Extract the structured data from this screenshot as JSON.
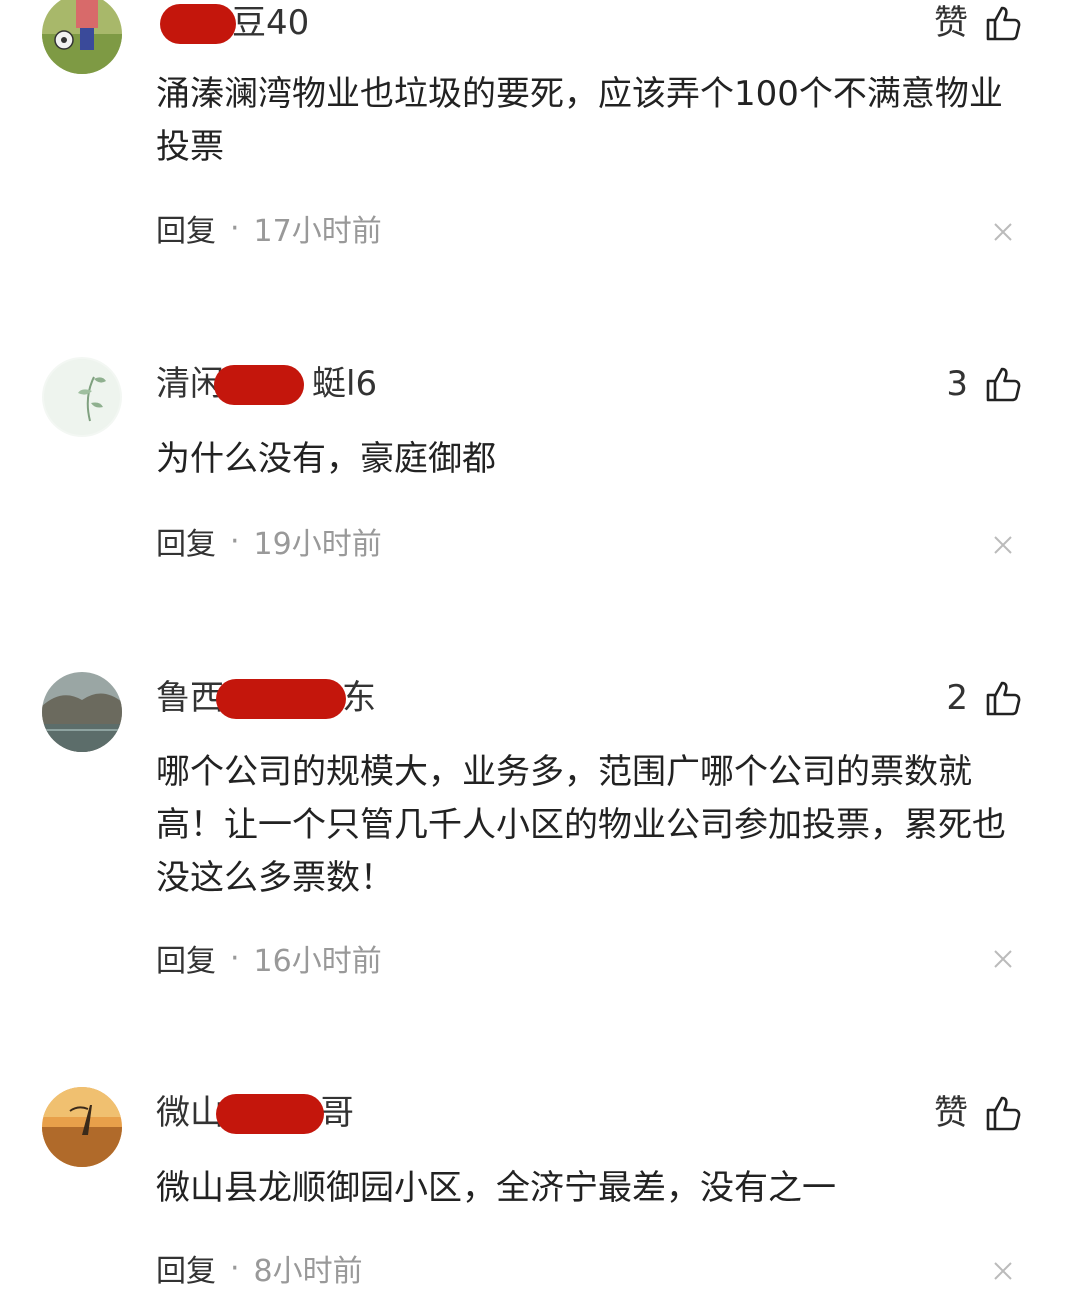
{
  "comments": [
    {
      "username_visible": "豆40",
      "like_label": "赞",
      "text": "涌溱澜湾物业也垃圾的要死，应该弄个100个不满意物业投票",
      "reply_label": "回复",
      "separator": "·",
      "time": "17小时前",
      "avatar_icon": "child-soccer-avatar-icon"
    },
    {
      "username_visible": "清闲蜓l6",
      "like_label": "3",
      "text": "为什么没有，豪庭御都",
      "reply_label": "回复",
      "separator": "·",
      "time": "19小时前",
      "avatar_icon": "ink-plant-avatar-icon"
    },
    {
      "username_visible": "鲁西东",
      "like_label": "2",
      "text": "哪个公司的规模大，业务多，范围广哪个公司的票数就高！让一个只管几千人小区的物业公司参加投票，累死也没这么多票数！",
      "reply_label": "回复",
      "separator": "·",
      "time": "16小时前",
      "avatar_icon": "landscape-avatar-icon"
    },
    {
      "username_visible": "微山哥",
      "like_label": "赞",
      "text": "微山县龙顺御园小区，全济宁最差，没有之一",
      "reply_label": "回复",
      "separator": "·",
      "time": "8小时前",
      "avatar_icon": "sunset-avatar-icon"
    }
  ],
  "colors": {
    "redaction": "#c4160c",
    "secondary_text": "#999999",
    "primary_text": "#222222"
  }
}
